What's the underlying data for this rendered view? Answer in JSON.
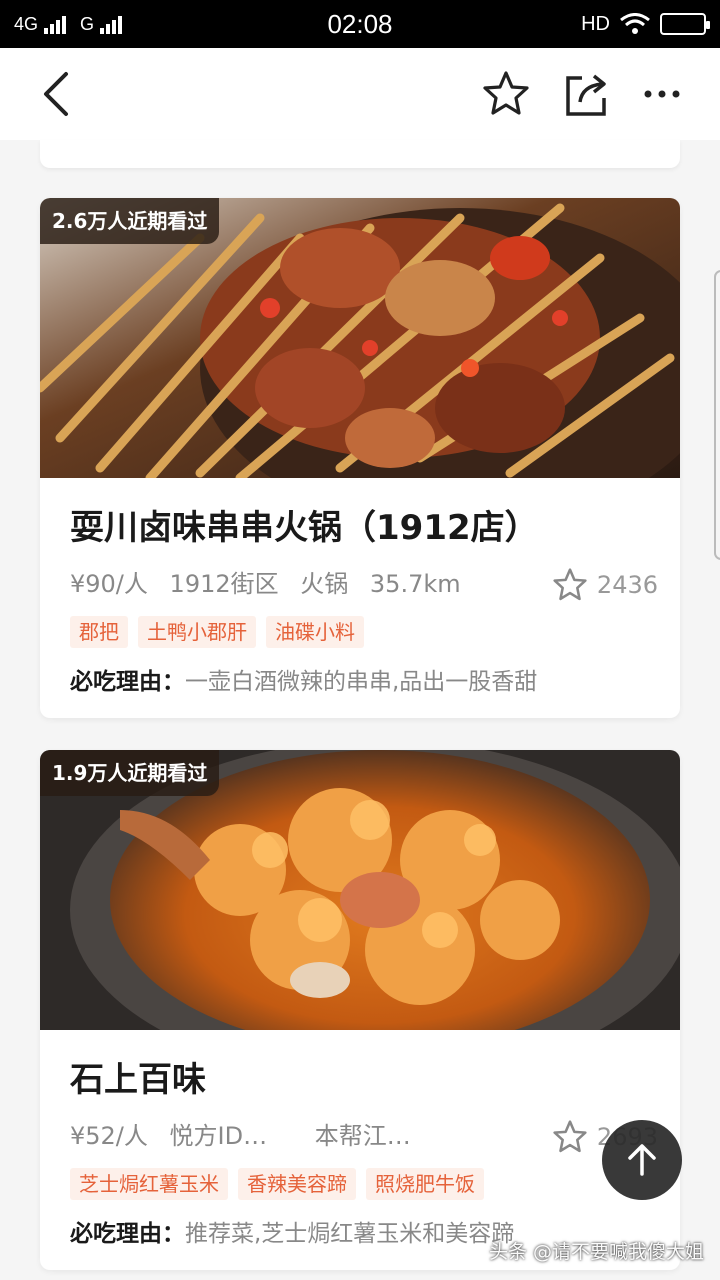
{
  "status_bar": {
    "net1": "4G",
    "net2": "G",
    "time": "02:08",
    "hd": "HD"
  },
  "nav": {
    "back_icon": "chevron-left-icon",
    "star_icon": "star-outline-icon",
    "share_icon": "share-icon",
    "more_icon": "more-horizontal-icon"
  },
  "cards": [
    {
      "views": "2.6万人近期看过",
      "title": "耍川卤味串串火锅（1912店）",
      "price": "¥90/人",
      "area": "1912街区",
      "category": "火锅",
      "distance": "35.7km",
      "fav_count": "2436",
      "tags": [
        "郡把",
        "土鸭小郡肝",
        "油碟小料"
      ],
      "reason_label": "必吃理由：",
      "reason_text": "一壶白酒微辣的串串,品出一股香甜"
    },
    {
      "views": "1.9万人近期看过",
      "title": "石上百味",
      "price": "¥52/人",
      "area": "悦方ID…",
      "category": "本帮江…",
      "distance": "",
      "fav_count": "2693",
      "tags": [
        "芝士焗红薯玉米",
        "香辣美容蹄",
        "照烧肥牛饭"
      ],
      "reason_label": "必吃理由：",
      "reason_text": "推荐菜,芝士焗红薯玉米和美容蹄"
    }
  ],
  "watermark": "头条 @请不要喊我傻大姐",
  "colors": {
    "tag_text": "#e5623a",
    "tag_bg": "#fdf0ea",
    "badge_bg": "#281c14"
  }
}
